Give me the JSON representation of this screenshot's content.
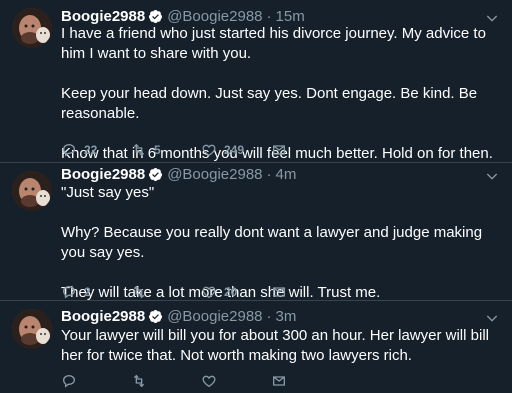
{
  "tweets": [
    {
      "name": "Boogie2988",
      "handle": "@Boogie2988",
      "separator": "·",
      "time": "15m",
      "paragraphs": [
        "I have a friend who just started his divorce journey.  My advice to him I want to share with you.",
        "Keep your head down.  Just say yes.  Dont engage.  Be kind.  Be reasonable.",
        "Know that in 6 months you will feel much better.  Hold on for then."
      ],
      "replies": "22",
      "retweets": "5",
      "likes": "249"
    },
    {
      "name": "Boogie2988",
      "handle": "@Boogie2988",
      "separator": "·",
      "time": "4m",
      "paragraphs": [
        "\"Just say yes\"",
        "Why?  Because you really dont want a lawyer and judge making you say yes.",
        "They will take a lot more than she will.  Trust me."
      ],
      "replies": "2",
      "retweets": "",
      "likes": "20"
    },
    {
      "name": "Boogie2988",
      "handle": "@Boogie2988",
      "separator": "·",
      "time": "3m",
      "paragraphs": [
        "Your lawyer will bill you for about 300 an hour.  Her lawyer will bill her for twice that.  Not worth making two lawyers rich."
      ],
      "replies": "",
      "retweets": "",
      "likes": ""
    }
  ],
  "colors": {
    "background": "#15202b",
    "text": "#ffffff",
    "secondary": "#8899a6",
    "verified": "#1da1f2",
    "divider": "#38444d"
  },
  "icons": {
    "reply": "reply-icon",
    "retweet": "retweet-icon",
    "like": "heart-icon",
    "share": "share-icon",
    "menu": "chevron-down-icon",
    "verified": "verified-badge-icon"
  }
}
